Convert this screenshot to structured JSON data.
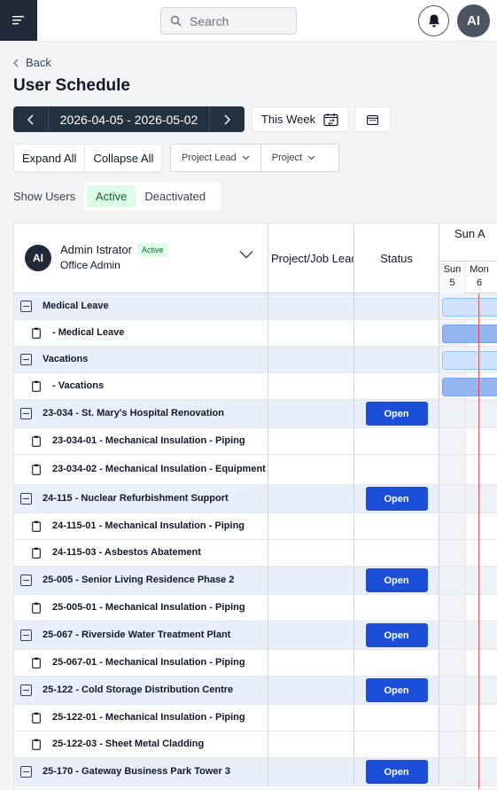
{
  "topbar": {
    "search_placeholder": "Search",
    "avatar_initials": "AI"
  },
  "nav": {
    "back_label": "Back"
  },
  "page": {
    "title": "User Schedule"
  },
  "datenav": {
    "range": "2026-04-05 - 2026-05-02",
    "this_week_label": "This Week"
  },
  "actions": {
    "expand_all": "Expand All",
    "collapse_all": "Collapse All"
  },
  "filters": {
    "project_lead": "Project Lead",
    "project": "Project"
  },
  "show_users": {
    "label": "Show Users",
    "active": "Active",
    "deactivated": "Deactivated"
  },
  "user": {
    "initials": "AI",
    "name": "Admin Istrator",
    "badge": "Active",
    "role": "Office Admin"
  },
  "columns": {
    "project_lead": "Project/Job Lead",
    "status": "Status",
    "week": "Sun A",
    "day1_name": "Sun",
    "day1_num": "5",
    "day2_name": "Mon",
    "day2_num": "6"
  },
  "rows": [
    {
      "name": "Medical Leave",
      "type": "parent",
      "bar": "light"
    },
    {
      "name": "- Medical Leave",
      "type": "child",
      "bar": "dark"
    },
    {
      "name": "Vacations",
      "type": "parent",
      "bar": "light"
    },
    {
      "name": "- Vacations",
      "type": "child",
      "bar": "dark"
    },
    {
      "name": "23-034 - St. Mary's Hospital Renovation",
      "type": "parent",
      "status": "Open"
    },
    {
      "name": "23-034-01 - Mechanical Insulation - Piping",
      "type": "child"
    },
    {
      "name": "23-034-02 - Mechanical Insulation - Equipment",
      "type": "child"
    },
    {
      "name": "24-115 - Nuclear Refurbishment Support",
      "type": "parent",
      "status": "Open"
    },
    {
      "name": "24-115-01 - Mechanical Insulation - Piping",
      "type": "child"
    },
    {
      "name": "24-115-03 - Asbestos Abatement",
      "type": "child"
    },
    {
      "name": "25-005 - Senior Living Residence Phase 2",
      "type": "parent",
      "status": "Open"
    },
    {
      "name": "25-005-01 - Mechanical Insulation - Piping",
      "type": "child"
    },
    {
      "name": "25-067 - Riverside Water Treatment Plant",
      "type": "parent",
      "status": "Open"
    },
    {
      "name": "25-067-01 - Mechanical Insulation - Piping",
      "type": "child"
    },
    {
      "name": "25-122 - Cold Storage Distribution Centre",
      "type": "parent",
      "status": "Open"
    },
    {
      "name": "25-122-01 - Mechanical Insulation - Piping",
      "type": "child"
    },
    {
      "name": "25-122-03 - Sheet Metal Cladding",
      "type": "child"
    },
    {
      "name": "25-170 - Gateway Business Park Tower 3",
      "type": "parent",
      "status": "Open"
    }
  ]
}
